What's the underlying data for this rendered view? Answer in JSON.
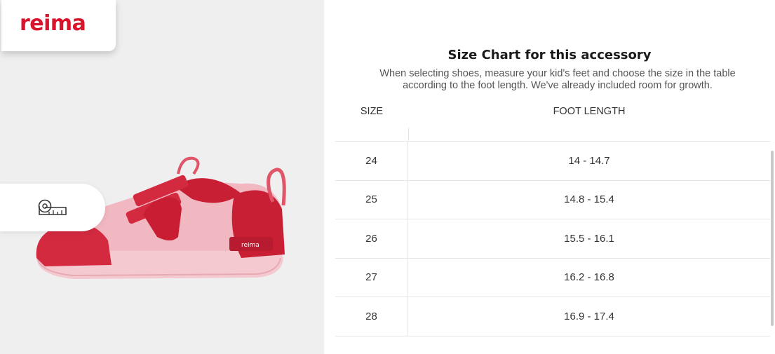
{
  "brand": {
    "logo": "reima",
    "accent_color": "#d8152c"
  },
  "product": {
    "image": "red-pink-kids-sneaker",
    "measure_icon": "tape-measure-icon"
  },
  "size_chart": {
    "title": "Size Chart for this accessory",
    "description": "When selecting shoes, measure your kid's feet and choose the size in the table according to the foot length. We've already included room for growth.",
    "columns": [
      "SIZE",
      "FOOT LENGTH"
    ],
    "rows": [
      {
        "size": "24",
        "foot_length": "14 - 14.7"
      },
      {
        "size": "25",
        "foot_length": "14.8 - 15.4"
      },
      {
        "size": "26",
        "foot_length": "15.5 - 16.1"
      },
      {
        "size": "27",
        "foot_length": "16.2 - 16.8"
      },
      {
        "size": "28",
        "foot_length": "16.9 - 17.4"
      }
    ]
  }
}
